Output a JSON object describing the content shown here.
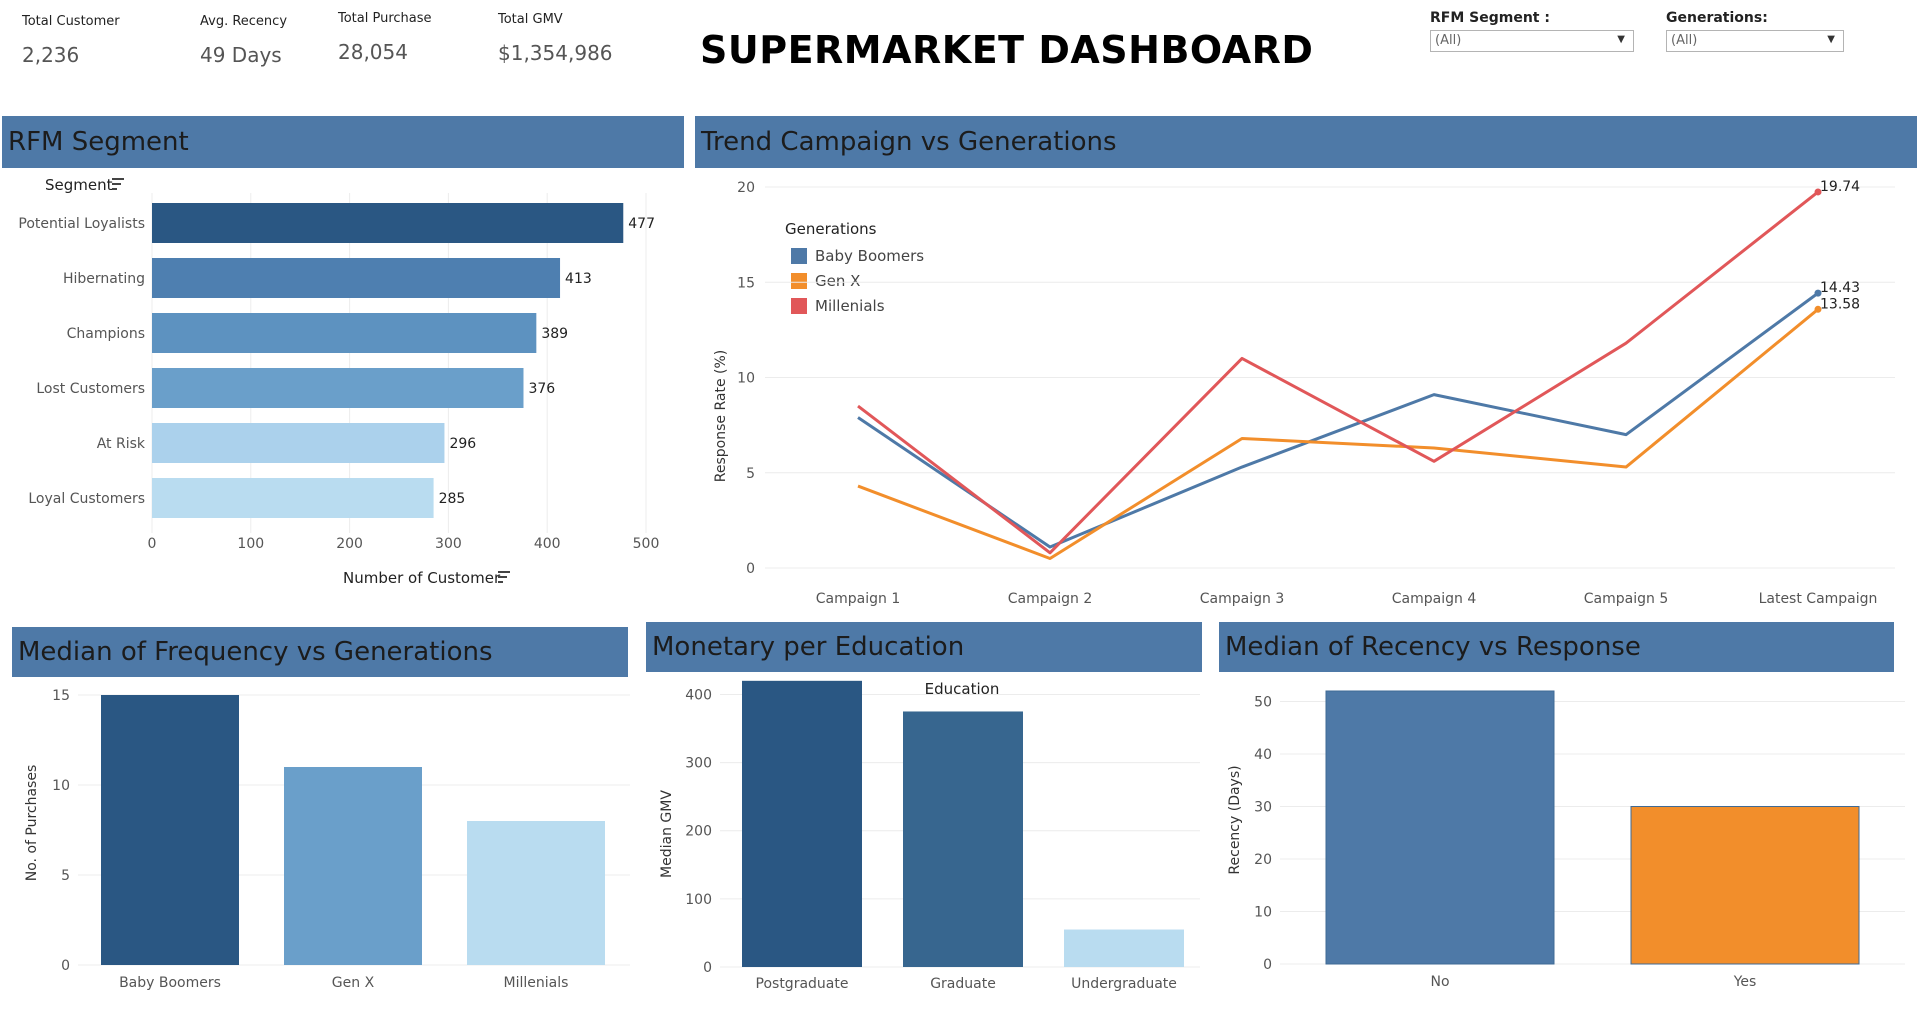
{
  "kpis": [
    {
      "label": "Total Customer",
      "value": "2,236"
    },
    {
      "label": "Avg. Recency",
      "value": "49 Days"
    },
    {
      "label": "Total Purchase",
      "value": "28,054"
    },
    {
      "label": "Total GMV",
      "value": "$1,354,986"
    }
  ],
  "title": "SUPERMARKET DASHBOARD",
  "filters": [
    {
      "label": "RFM Segment :",
      "value": "(All)"
    },
    {
      "label": "Generations:",
      "value": "(All)"
    }
  ],
  "panels": {
    "rfm": "RFM Segment",
    "trend": "Trend Campaign vs Generations",
    "freq": "Median of Frequency vs Generations",
    "monetary": "Monetary per Education",
    "recency": "Median of Recency vs Response"
  },
  "colors": {
    "header": "#4e79a7",
    "blue": "#4e79a7",
    "orange": "#f28e2b",
    "red": "#e15759"
  },
  "chart_data": [
    {
      "id": "rfm",
      "type": "bar",
      "orientation": "horizontal",
      "categories": [
        "Potential Loyalists",
        "Hibernating",
        "Champions",
        "Lost Customers",
        "At Risk",
        "Loyal Customers"
      ],
      "values": [
        477,
        413,
        389,
        376,
        296,
        285
      ],
      "colors": [
        "#2a5783",
        "#4e7fb0",
        "#5d92c0",
        "#6a9fca",
        "#abd1ec",
        "#b9dcf0"
      ],
      "ylabel": "Segment",
      "xlabel": "Number of Customer",
      "xlim": [
        0,
        500
      ],
      "xticks": [
        0,
        100,
        200,
        300,
        400,
        500
      ]
    },
    {
      "id": "trend",
      "type": "line",
      "categories": [
        "Campaign 1",
        "Campaign 2",
        "Campaign 3",
        "Campaign 4",
        "Campaign 5",
        "Latest Campaign"
      ],
      "series": [
        {
          "name": "Baby Boomers",
          "color": "#4e79a7",
          "values": [
            7.9,
            1.1,
            5.3,
            9.1,
            7.0,
            14.43
          ]
        },
        {
          "name": "Gen X",
          "color": "#f28e2b",
          "values": [
            4.3,
            0.5,
            6.8,
            6.3,
            5.3,
            13.58
          ]
        },
        {
          "name": "Millenials",
          "color": "#e15759",
          "values": [
            8.5,
            0.8,
            11.0,
            5.6,
            11.8,
            19.74
          ]
        }
      ],
      "end_labels": [
        "14.43",
        "13.58",
        "19.74"
      ],
      "legend_title": "Generations",
      "ylabel": "Response Rate (%)",
      "ylim": [
        0,
        20
      ],
      "yticks": [
        0,
        5,
        10,
        15,
        20
      ]
    },
    {
      "id": "freq",
      "type": "bar",
      "categories": [
        "Baby Boomers",
        "Gen X",
        "Millenials"
      ],
      "values": [
        15,
        11,
        8
      ],
      "colors": [
        "#2a5783",
        "#6a9fca",
        "#b9dcf0"
      ],
      "ylabel": "No. of Purchases",
      "ylim": [
        0,
        15
      ],
      "yticks": [
        0,
        5,
        10,
        15
      ]
    },
    {
      "id": "monetary",
      "type": "bar",
      "categories": [
        "Postgraduate",
        "Graduate",
        "Undergraduate"
      ],
      "values": [
        420,
        375,
        55
      ],
      "colors": [
        "#2a5783",
        "#37668f",
        "#b9dcf0"
      ],
      "title": "Education",
      "ylabel": "Median GMV",
      "ylim": [
        0,
        430
      ],
      "yticks": [
        0,
        100,
        200,
        300,
        400
      ]
    },
    {
      "id": "recency",
      "type": "bar",
      "categories": [
        "No",
        "Yes"
      ],
      "values": [
        52,
        30
      ],
      "colors": [
        "#4e79a7",
        "#f28e2b"
      ],
      "ylabel": "Recency (Days)",
      "ylim": [
        0,
        52
      ],
      "yticks": [
        0,
        10,
        20,
        30,
        40,
        50
      ]
    }
  ]
}
